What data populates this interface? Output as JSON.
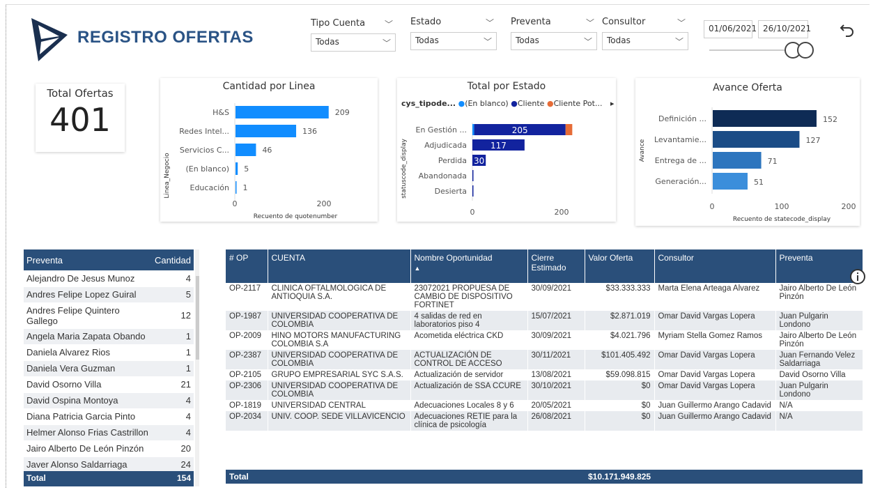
{
  "header": {
    "title": "REGISTRO OFERTAS"
  },
  "filters": [
    {
      "label": "Tipo Cuenta",
      "value": "Todas"
    },
    {
      "label": "Estado",
      "value": "Todas"
    },
    {
      "label": "Preventa",
      "value": "Todas"
    },
    {
      "label": "Consultor",
      "value": "Todas"
    }
  ],
  "date_range": {
    "start": "01/06/2021",
    "end": "26/10/2021"
  },
  "kpi": {
    "label": "Total Ofertas",
    "value": "401"
  },
  "charts": {
    "linea": {
      "title": "Cantidad por Linea",
      "ylabel": "Linea_Negocio",
      "xlabel": "Recuento de quotenumber",
      "ticks": [
        "0",
        "200"
      ]
    },
    "estado": {
      "title": "Total por Estado",
      "legend_title": "cys_tipode...",
      "legend": [
        "(En blanco)",
        "Cliente",
        "Cliente Pot..."
      ],
      "ylabel": "statuscode_display",
      "ticks": [
        "0",
        "200"
      ]
    },
    "avance": {
      "title": "Avance Oferta",
      "ylabel": "Avance",
      "xlabel": "Recuento de statecode_display",
      "ticks": [
        "0",
        "100",
        "200"
      ]
    }
  },
  "chart_data": [
    {
      "type": "bar",
      "title": "Cantidad por Linea",
      "categories": [
        "H&S",
        "Redes Intel...",
        "Servicios C...",
        "(En blanco)",
        "Educación"
      ],
      "values": [
        209,
        136,
        46,
        5,
        1
      ],
      "xlabel": "Recuento de quotenumber",
      "ylabel": "Linea_Negocio",
      "xlim": [
        0,
        240
      ],
      "color": "#118DFF"
    },
    {
      "type": "bar",
      "title": "Total por Estado",
      "categories": [
        "En Gestión ...",
        "Adjudicada",
        "Perdida",
        "Abandonada",
        "Desierta"
      ],
      "series": [
        {
          "name": "(En blanco)",
          "values": [
            4,
            0,
            0,
            0,
            0
          ],
          "color": "#118DFF"
        },
        {
          "name": "Cliente",
          "values": [
            205,
            117,
            30,
            1,
            1
          ],
          "color": "#12239E"
        },
        {
          "name": "Cliente Pot...",
          "values": [
            15,
            0,
            0,
            0,
            0
          ],
          "color": "#E66C37"
        }
      ],
      "labels": [
        "205",
        "117",
        "30",
        "",
        ""
      ],
      "ylabel": "statuscode_display",
      "xlim": [
        0,
        240
      ]
    },
    {
      "type": "bar",
      "title": "Avance Oferta",
      "categories": [
        "Definición ...",
        "Levantamie...",
        "Entrega de ...",
        "Generación..."
      ],
      "values": [
        152,
        127,
        71,
        51
      ],
      "colors": [
        "#0E2B55",
        "#1B4C86",
        "#2D75BE",
        "#3B8EDB"
      ],
      "xlabel": "Recuento de statecode_display",
      "ylabel": "Avance",
      "xlim": [
        0,
        200
      ]
    }
  ],
  "preventa": {
    "headers": [
      "Preventa",
      "Cantidad"
    ],
    "rows": [
      [
        "Alejandro De Jesus Munoz",
        "4"
      ],
      [
        "Andres Felipe Lopez Guiral",
        "5"
      ],
      [
        "Andres Felipe Quintero Gallego",
        "12"
      ],
      [
        "Angela Maria Zapata Obando",
        "1"
      ],
      [
        "Daniela Alvarez Rios",
        "1"
      ],
      [
        "Daniela Vera Guzman",
        "1"
      ],
      [
        "David Osorno Villa",
        "21"
      ],
      [
        "David Ospina Montoya",
        "4"
      ],
      [
        "Diana Patricia Garcia Pinto",
        "4"
      ],
      [
        "Helmer Alonso Frias Castrillon",
        "4"
      ],
      [
        "Jairo Alberto De León Pinzón",
        "20"
      ],
      [
        "Javer Alonso Saldarriaga",
        "24"
      ]
    ],
    "total_label": "Total",
    "total": "154"
  },
  "ofertas": {
    "headers": [
      "# OP",
      "CUENTA",
      "Nombre Oportunidad",
      "Cierre Estimado",
      "Valor Oferta",
      "Consultor",
      "Preventa"
    ],
    "rows": [
      [
        "OP-2117",
        "CLINICA OFTALMOLOGICA DE ANTIOQUIA S.A.",
        "23072021 PROPUESA DE CAMBIO DE DISPOSITIVO FORTINET",
        "30/09/2021",
        "$33.333.333",
        "Marta Elena Arteaga Alvarez",
        "Jairo Alberto De León Pinzón"
      ],
      [
        "OP-1987",
        "UNIVERSIDAD COOPERATIVA DE COLOMBIA",
        "4 salidas de red en laboratorios piso 4",
        "15/07/2021",
        "$2.871.019",
        "Omar David Vargas Lopera",
        "Juan Pulgarin Londono"
      ],
      [
        "OP-2009",
        "HINO MOTORS MANUFACTURING COLOMBIA S.A",
        "Acometida eléctrica CKD",
        "30/09/2021",
        "$4.021.796",
        "Myriam Stella Gomez Ramos",
        "Jairo Alberto De León Pinzón"
      ],
      [
        "OP-2387",
        "UNIVERSIDAD COOPERATIVA DE COLOMBIA",
        "ACTUALIZACIÓN DE CONTROL DE ACCESO",
        "30/11/2021",
        "$101.405.492",
        "Omar David Vargas Lopera",
        "Juan Fernando Velez Saldarriaga"
      ],
      [
        "OP-2105",
        "GRUPO EMPRESARIAL SYC S.A.S.",
        "Actualización de servidor",
        "13/08/2021",
        "$59.098.815",
        "Omar David Vargas Lopera",
        "David Osorno Villa"
      ],
      [
        "OP-2306",
        "UNIVERSIDAD COOPERATIVA DE COLOMBIA",
        "Actualización de SSA CCURE",
        "30/10/2021",
        "$0",
        "Omar David Vargas Lopera",
        "Juan Pulgarin Londono"
      ],
      [
        "OP-1819",
        "UNIVERSIDAD CENTRAL",
        "Adecuaciones Locales 8 y 6",
        "20/05/2021",
        "$0",
        "Juan Guillermo Arango Cadavid",
        "N/A"
      ],
      [
        "OP-2034",
        "UNIV. COOP. SEDE VILLAVICENCIO",
        "Adecuaciones RETIE para la clínica de psicología",
        "26/08/2021",
        "$0",
        "Juan Guillermo Arango Cadavid",
        "N/A"
      ]
    ],
    "total_label": "Total",
    "total": "$10.171.949.825"
  }
}
